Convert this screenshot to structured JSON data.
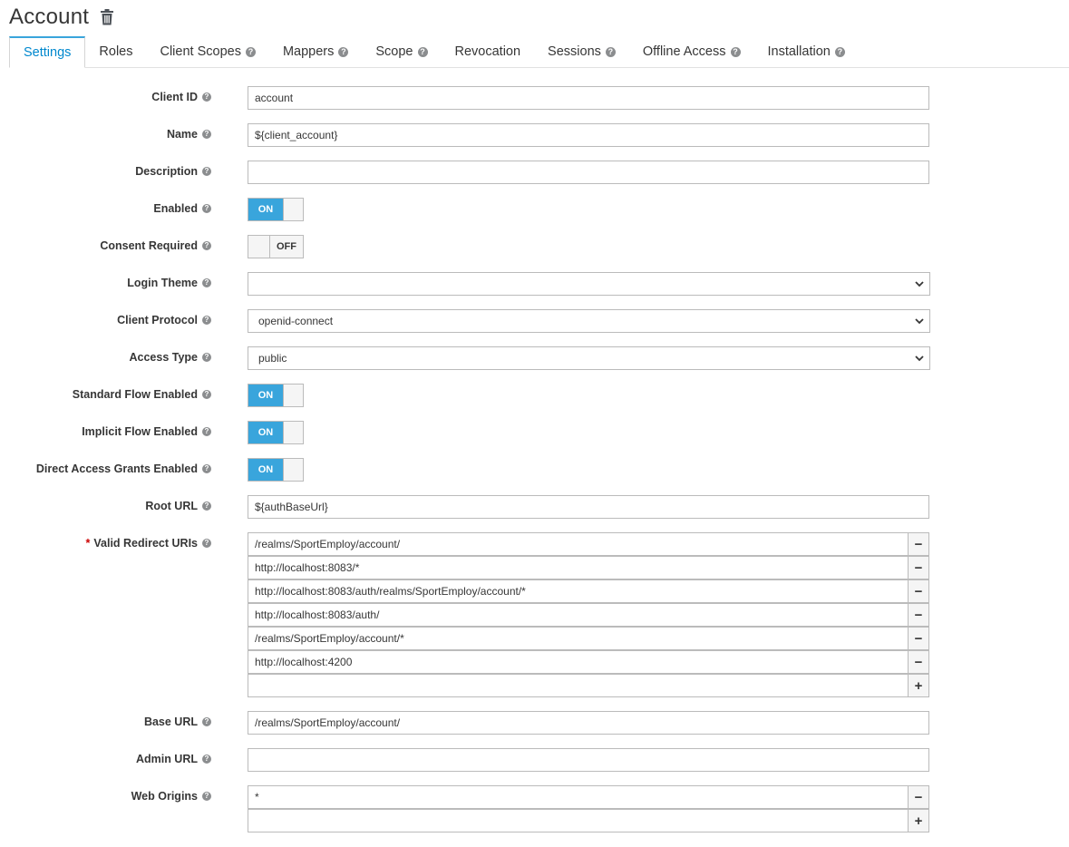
{
  "header": {
    "title": "Account"
  },
  "tabs": [
    {
      "label": "Settings",
      "help": false,
      "active": true
    },
    {
      "label": "Roles",
      "help": false
    },
    {
      "label": "Client Scopes",
      "help": true
    },
    {
      "label": "Mappers",
      "help": true
    },
    {
      "label": "Scope",
      "help": true
    },
    {
      "label": "Revocation",
      "help": false
    },
    {
      "label": "Sessions",
      "help": true
    },
    {
      "label": "Offline Access",
      "help": true
    },
    {
      "label": "Installation",
      "help": true
    }
  ],
  "form": {
    "client_id": {
      "label": "Client ID",
      "value": "account"
    },
    "name": {
      "label": "Name",
      "value": "${client_account}"
    },
    "description": {
      "label": "Description",
      "value": ""
    },
    "enabled": {
      "label": "Enabled",
      "state": "ON"
    },
    "consent_required": {
      "label": "Consent Required",
      "state": "OFF"
    },
    "login_theme": {
      "label": "Login Theme",
      "value": ""
    },
    "client_protocol": {
      "label": "Client Protocol",
      "value": "openid-connect"
    },
    "access_type": {
      "label": "Access Type",
      "value": "public"
    },
    "standard_flow": {
      "label": "Standard Flow Enabled",
      "state": "ON"
    },
    "implicit_flow": {
      "label": "Implicit Flow Enabled",
      "state": "ON"
    },
    "direct_access": {
      "label": "Direct Access Grants Enabled",
      "state": "ON"
    },
    "root_url": {
      "label": "Root URL",
      "value": "${authBaseUrl}"
    },
    "redirect_uris": {
      "required_mark": "*",
      "label": "Valid Redirect URIs",
      "items": [
        "/realms/SportEmploy/account/",
        "http://localhost:8083/*",
        "http://localhost:8083/auth/realms/SportEmploy/account/*",
        "http://localhost:8083/auth/",
        "/realms/SportEmploy/account/*",
        "http://localhost:4200",
        ""
      ]
    },
    "base_url": {
      "label": "Base URL",
      "value": "/realms/SportEmploy/account/"
    },
    "admin_url": {
      "label": "Admin URL",
      "value": ""
    },
    "web_origins": {
      "label": "Web Origins",
      "items": [
        "*",
        ""
      ]
    }
  },
  "symbols": {
    "remove": "−",
    "add": "+",
    "help": "?"
  }
}
